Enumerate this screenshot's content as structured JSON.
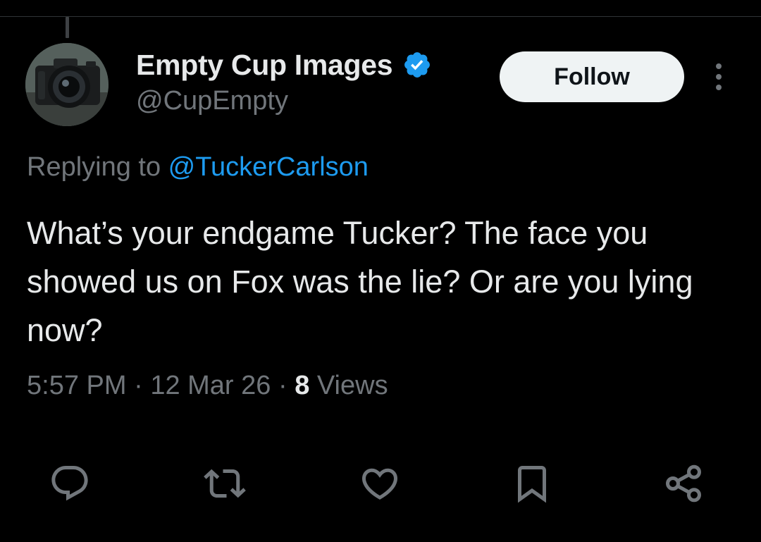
{
  "author": {
    "display_name": "Empty Cup Images",
    "handle": "@CupEmpty",
    "verified": true,
    "avatar_icon": "camera-avatar"
  },
  "follow_button": {
    "label": "Follow"
  },
  "reply_context": {
    "prefix": "Replying to ",
    "mention": "@TuckerCarlson"
  },
  "tweet": {
    "text": "What’s your endgame Tucker? The face you showed us on Fox was the lie? Or are you lying now?"
  },
  "meta": {
    "time": "5:57 PM",
    "separator": " · ",
    "date": "12 Mar 26",
    "views_count": "8",
    "views_label": " Views"
  },
  "actions": [
    {
      "name": "reply",
      "icon": "reply-icon"
    },
    {
      "name": "retweet",
      "icon": "retweet-icon"
    },
    {
      "name": "like",
      "icon": "heart-icon"
    },
    {
      "name": "bookmark",
      "icon": "bookmark-icon"
    },
    {
      "name": "share",
      "icon": "share-icon"
    }
  ],
  "colors": {
    "background": "#000000",
    "text_primary": "#e7e9ea",
    "text_secondary": "#71767b",
    "link": "#1d9bf0",
    "verified_badge": "#1d9bf0",
    "follow_bg": "#eff3f4"
  }
}
